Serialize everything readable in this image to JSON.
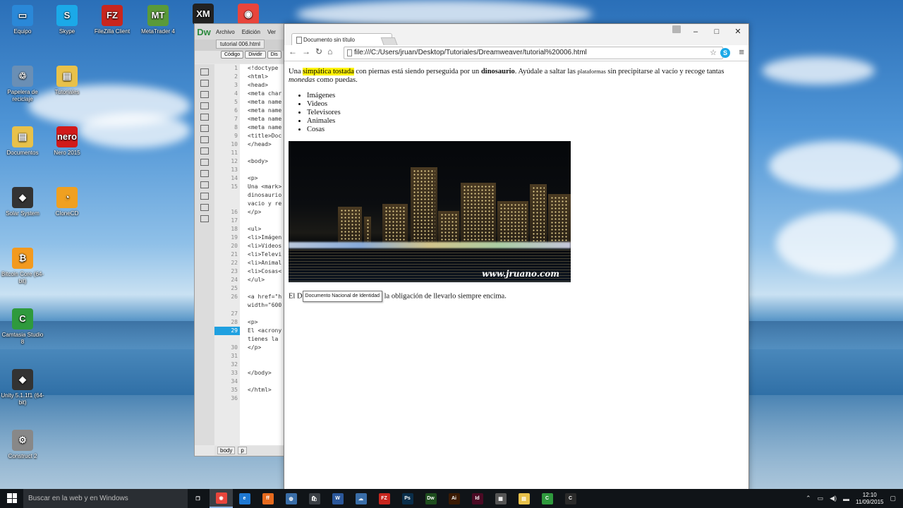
{
  "desktop_icons": [
    {
      "label": "Equipo",
      "glyph": "▭",
      "color": "#2a88d8"
    },
    {
      "label": "Skype",
      "glyph": "S",
      "color": "#1ba9e8"
    },
    {
      "label": "FileZilla Client",
      "glyph": "FZ",
      "color": "#c8261e"
    },
    {
      "label": "MetaTrader 4",
      "glyph": "MT",
      "color": "#5a9a3a"
    },
    {
      "label": "",
      "glyph": "XM",
      "color": "#222222"
    },
    {
      "label": "",
      "glyph": "◉",
      "color": "#e8453c"
    },
    {
      "label": "Papelera de reciclaje",
      "glyph": "♲",
      "color": "#6a8fb5"
    },
    {
      "label": "Tutoriales",
      "glyph": "▤",
      "color": "#e8c14a"
    },
    {
      "label": "Documentos",
      "glyph": "▤",
      "color": "#e8c14a"
    },
    {
      "label": "Nero 2015",
      "glyph": "nero",
      "color": "#d11a1a"
    },
    {
      "label": "Solar System",
      "glyph": "◆",
      "color": "#333333"
    },
    {
      "label": "CloneCD",
      "glyph": "◔",
      "color": "#f0a020"
    },
    {
      "label": "Bitcoin Core (64-bit)",
      "glyph": "₿",
      "color": "#f39a1e"
    },
    {
      "label": "Camtasia Studio 8",
      "glyph": "C",
      "color": "#2f9a3d"
    },
    {
      "label": "Unity 5.1.1f1 (64-bit)",
      "glyph": "◆",
      "color": "#333333"
    },
    {
      "label": "Construct 2",
      "glyph": "⚙",
      "color": "#888888"
    }
  ],
  "dreamweaver": {
    "logo": "Dw",
    "menu": [
      "Archivo",
      "Edición",
      "Ver"
    ],
    "file_tab": "tutorial 006.html",
    "toolbar": [
      "Código",
      "Dividir",
      "Dis"
    ],
    "line_numbers": [
      "1",
      "2",
      "3",
      "4",
      "5",
      "6",
      "7",
      "8",
      "9",
      "10",
      "11",
      "12",
      "13",
      "14",
      "15",
      "",
      "",
      "16",
      "17",
      "18",
      "19",
      "20",
      "21",
      "22",
      "23",
      "24",
      "25",
      "26",
      "",
      "27",
      "28",
      "29",
      "",
      "30",
      "31",
      "32",
      "33",
      "34",
      "35",
      "36"
    ],
    "current_line_index": 31,
    "code_lines": [
      "<!doctype",
      "<html>",
      "<head>",
      "<meta char",
      "<meta name",
      "<meta name",
      "<meta name",
      "<meta name",
      "<title>Doc",
      "</head>",
      "",
      "<body>",
      "",
      "<p>",
      "Una <mark>",
      "dinosaurio",
      "vacio y re",
      "</p>",
      "",
      "<ul>",
      "<li>Imágen",
      "<li>Videos",
      "<li>Televi",
      "<li>Animal",
      "<li>Cosas<",
      "</ul>",
      "",
      "<a href=\"h",
      "width=\"600",
      "",
      "<p>",
      "El <acrony",
      "tienes la ",
      "</p>",
      "",
      "",
      "</body>",
      "",
      "</html>",
      ""
    ],
    "status_tags": [
      "body",
      "p"
    ]
  },
  "browser": {
    "tab_title": "Documento sin título",
    "url": "file:///C:/Users/jruan/Desktop/Tutoriales/Dreamweaver/tutorial%20006.html",
    "page": {
      "p1": {
        "t1": "Una ",
        "mark": "simpática tostada",
        "t2": " con piernas está siendo perseguida por un ",
        "bold": "dinosaurio",
        "t3": ". Ayúdale a saltar las ",
        "small": "plataformas",
        "t4": " sin precipitarse al vacío y recoge tantas ",
        "em": "monedas",
        "t5": " como puedas."
      },
      "list": [
        "Imágenes",
        "Videos",
        "Televisores",
        "Animales",
        "Cosas"
      ],
      "image_watermark": "www.jruano.com",
      "p2": {
        "t1": "El D",
        "tooltip": "Documento Nacional de Identidad",
        "t2": " la obligación de llevarlo siempre encima."
      }
    }
  },
  "taskbar": {
    "search_placeholder": "Buscar en la web y en Windows",
    "apps": [
      {
        "name": "task-view",
        "glyph": "❐",
        "color": "#101418"
      },
      {
        "name": "chrome",
        "glyph": "◉",
        "color": "#e8453c",
        "active": true
      },
      {
        "name": "edge",
        "glyph": "e",
        "color": "#1e78d2"
      },
      {
        "name": "firefox",
        "glyph": "ff",
        "color": "#e66a1e"
      },
      {
        "name": "network",
        "glyph": "◍",
        "color": "#3a6ea8"
      },
      {
        "name": "store",
        "glyph": "🛍",
        "color": "#3a3f45"
      },
      {
        "name": "word",
        "glyph": "W",
        "color": "#2b579a"
      },
      {
        "name": "skydrive",
        "glyph": "☁",
        "color": "#3a6ea8"
      },
      {
        "name": "filezilla",
        "glyph": "FZ",
        "color": "#c8261e"
      },
      {
        "name": "photoshop",
        "glyph": "Ps",
        "color": "#0a2e4a"
      },
      {
        "name": "dreamweaver",
        "glyph": "Dw",
        "color": "#1e4d1e"
      },
      {
        "name": "illustrator",
        "glyph": "Ai",
        "color": "#3a1a04"
      },
      {
        "name": "indesign",
        "glyph": "Id",
        "color": "#4a0a24"
      },
      {
        "name": "calculator",
        "glyph": "▦",
        "color": "#555555"
      },
      {
        "name": "explorer",
        "glyph": "▤",
        "color": "#e8c14a"
      },
      {
        "name": "camtasia",
        "glyph": "C",
        "color": "#2f9a3d"
      },
      {
        "name": "camtasia-recorder",
        "glyph": "C",
        "color": "#2a2a2a"
      }
    ],
    "time": "12:10",
    "date": "11/09/2015"
  }
}
